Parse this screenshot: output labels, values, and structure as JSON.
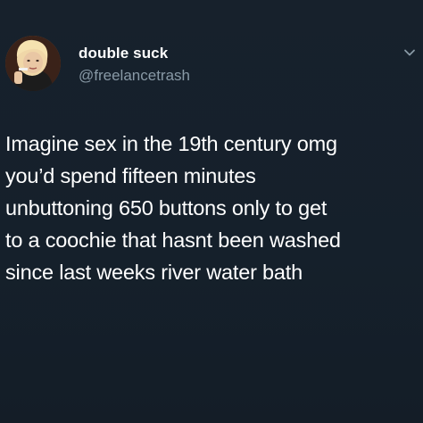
{
  "user": {
    "display_name": "double suck",
    "handle": "@freelancetrash",
    "avatar_icon": "profile-photo"
  },
  "tweet": {
    "lines": [
      "Imagine sex in the 19th century omg",
      "you’d spend fifteen minutes",
      "unbuttoning 650 buttons only to get",
      "to a coochie that hasnt been washed",
      "since last weeks river water bath"
    ]
  },
  "colors": {
    "background": "#15202b",
    "primary_text": "#ffffff",
    "secondary_text": "#8899a6"
  },
  "icons": {
    "menu": "chevron-down-icon"
  }
}
